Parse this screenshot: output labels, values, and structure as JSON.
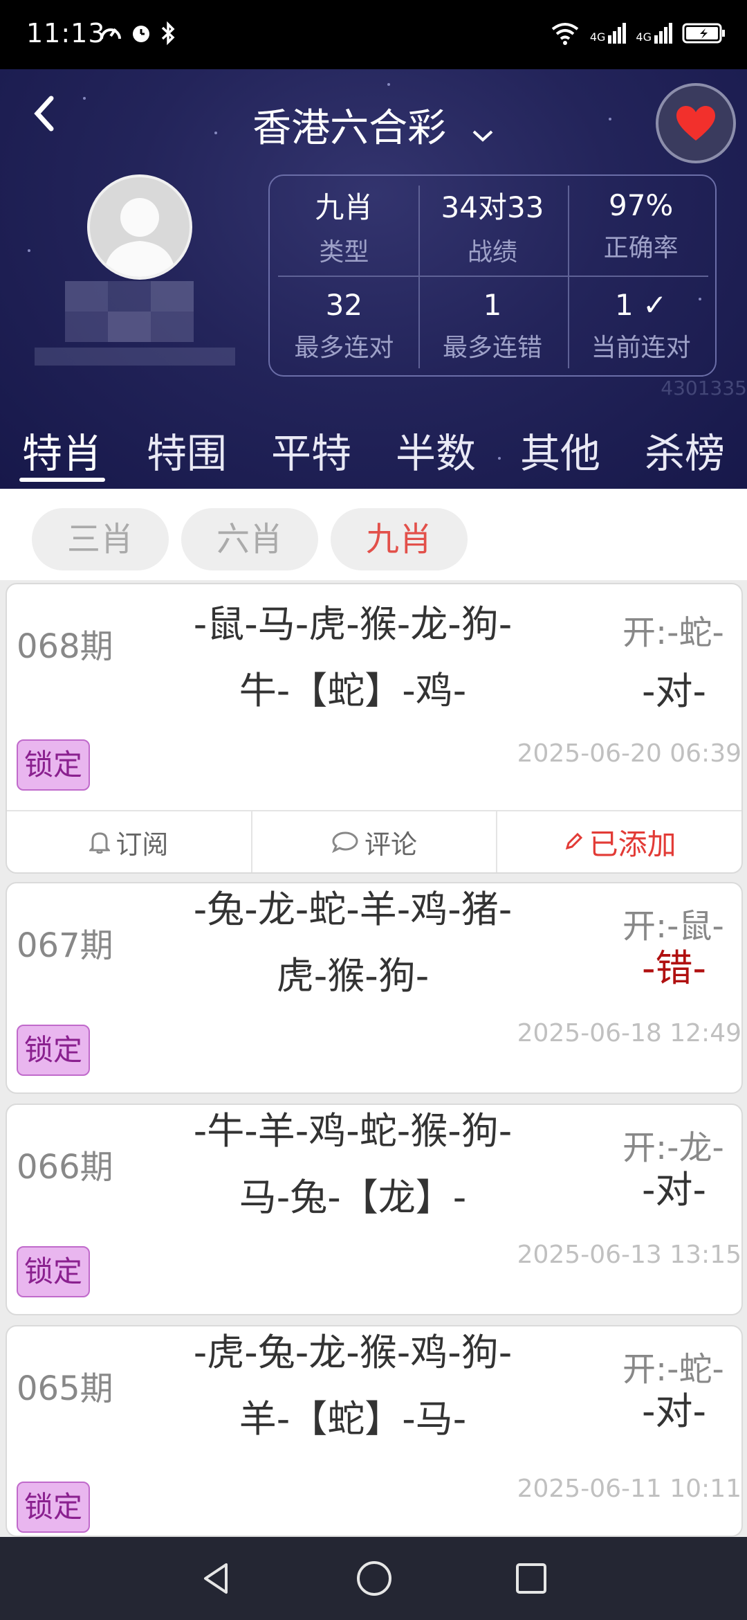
{
  "status_bar": {
    "time": "11:13",
    "network_a": "4G",
    "network_b": "4G"
  },
  "header": {
    "title": "香港六合彩",
    "stats": [
      {
        "value": "九肖",
        "label": "类型"
      },
      {
        "value": "34对33",
        "label": "战绩"
      },
      {
        "value": "97%",
        "label": "正确率"
      },
      {
        "value": "32",
        "label": "最多连对"
      },
      {
        "value": "1",
        "label": "最多连错"
      },
      {
        "value": "1 ✓",
        "label": "当前连对"
      }
    ],
    "watermark": "4301335"
  },
  "tabs": [
    "特肖",
    "特围",
    "平特",
    "半数",
    "其他",
    "杀榜"
  ],
  "chips": [
    "三肖",
    "六肖",
    "九肖"
  ],
  "records": [
    {
      "period": "068期",
      "line1": "-鼠-马-虎-猴-龙-狗-",
      "line2": "牛-【蛇】-鸡-",
      "open": "开:-蛇-",
      "result": "-对-",
      "lock": "锁定",
      "time": "2025-06-20 06:39"
    },
    {
      "period": "067期",
      "line1": "-兔-龙-蛇-羊-鸡-猪-",
      "line2": "虎-猴-狗-",
      "open": "开:-鼠-",
      "result": "-错-",
      "lock": "锁定",
      "time": "2025-06-18 12:49"
    },
    {
      "period": "066期",
      "line1": "-牛-羊-鸡-蛇-猴-狗-",
      "line2": "马-兔-【龙】-",
      "open": "开:-龙-",
      "result": "-对-",
      "lock": "锁定",
      "time": "2025-06-13 13:15"
    },
    {
      "period": "065期",
      "line1": "-虎-兔-龙-猴-鸡-狗-",
      "line2": "羊-【蛇】-马-",
      "open": "开:-蛇-",
      "result": "-对-",
      "lock": "锁定",
      "time": "2025-06-11 10:11"
    }
  ],
  "actions": {
    "subscribe": "订阅",
    "comment": "评论",
    "added": "已添加"
  }
}
